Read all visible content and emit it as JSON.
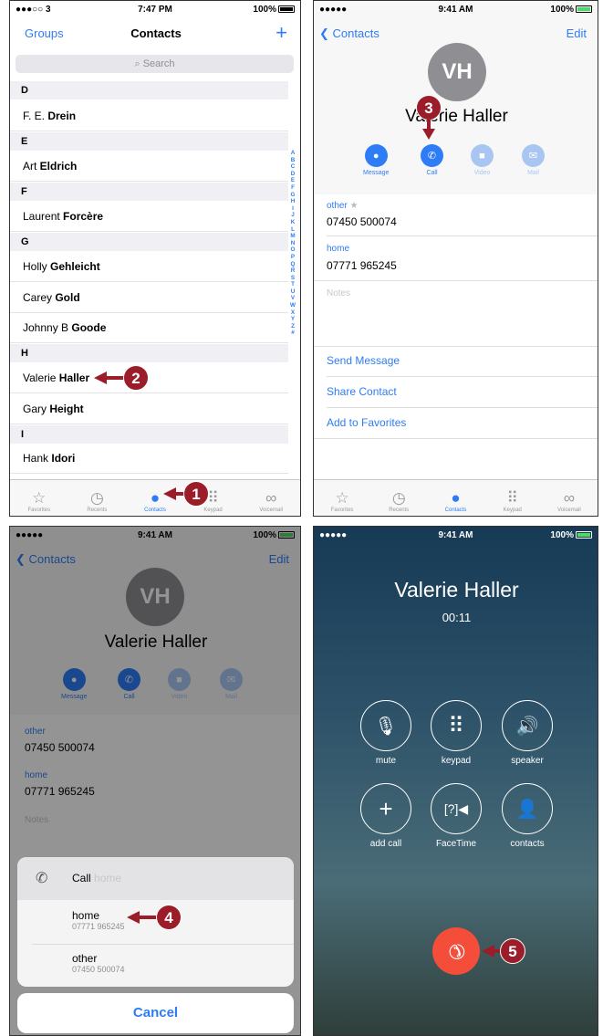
{
  "colors": {
    "accent": "#2e7cf6",
    "callout": "#9b1d2a",
    "end_call": "#f44e3b",
    "search_bg": "#e6e6eb"
  },
  "panel1": {
    "status": {
      "carrier": "●●●○○ 3 ",
      "time": "7:47 PM",
      "battery": "100%"
    },
    "nav": {
      "left": "Groups",
      "title": "Contacts",
      "add": "+"
    },
    "search": {
      "placeholder": "Search",
      "icon": "search-icon"
    },
    "sections": [
      {
        "letter": "D",
        "rows": [
          {
            "first": "F. E. ",
            "last": "Drein"
          }
        ]
      },
      {
        "letter": "E",
        "rows": [
          {
            "first": "Art ",
            "last": "Eldrich"
          }
        ]
      },
      {
        "letter": "F",
        "rows": [
          {
            "first": "Laurent ",
            "last": "Forcère"
          }
        ]
      },
      {
        "letter": "G",
        "rows": [
          {
            "first": "Holly ",
            "last": "Gehleicht"
          },
          {
            "first": "Carey ",
            "last": "Gold"
          },
          {
            "first": "Johnny B ",
            "last": "Goode"
          }
        ]
      },
      {
        "letter": "H",
        "rows": [
          {
            "first": "Valerie ",
            "last": "Haller"
          },
          {
            "first": "Gary ",
            "last": "Height"
          }
        ]
      },
      {
        "letter": "I",
        "rows": [
          {
            "first": "Hank ",
            "last": "Idori"
          }
        ]
      }
    ],
    "index": "A B C D E F G H I J K L M N O P Q R S T U V W X Y Z #",
    "tabs": [
      {
        "label": "Favorites",
        "icon": "star-icon"
      },
      {
        "label": "Recents",
        "icon": "clock-icon"
      },
      {
        "label": "Contacts",
        "icon": "person-icon"
      },
      {
        "label": "Keypad",
        "icon": "keypad-icon"
      },
      {
        "label": "Voicemail",
        "icon": "voicemail-icon"
      }
    ],
    "callout1": "1",
    "callout2": "2"
  },
  "panel2": {
    "status": {
      "carrier": "●●●●● ",
      "time": "9:41 AM",
      "battery": "100%"
    },
    "nav": {
      "back": "Contacts",
      "edit": "Edit"
    },
    "initials": "VH",
    "name": "Valerie Haller",
    "actions": [
      {
        "label": "Message",
        "icon": "message-icon"
      },
      {
        "label": "Call",
        "icon": "phone-icon"
      },
      {
        "label": "Video",
        "icon": "video-icon"
      },
      {
        "label": "Mail",
        "icon": "mail-icon"
      }
    ],
    "phones": [
      {
        "label": "other",
        "star": "★",
        "number": "07450 500074"
      },
      {
        "label": "home",
        "number": "07771 965245"
      }
    ],
    "notes": "Notes",
    "links": [
      "Send Message",
      "Share Contact",
      "Add to Favorites"
    ],
    "tabs": [
      {
        "label": "Favorites"
      },
      {
        "label": "Recents"
      },
      {
        "label": "Contacts"
      },
      {
        "label": "Keypad"
      },
      {
        "label": "Voicemail"
      }
    ],
    "callout3": "3"
  },
  "panel3": {
    "status": {
      "carrier": "●●●●● ",
      "time": "9:41 AM",
      "battery": "100%"
    },
    "nav": {
      "back": "Contacts",
      "edit": "Edit"
    },
    "initials": "VH",
    "name": "Valerie Haller",
    "actions": [
      {
        "label": "Message"
      },
      {
        "label": "Call"
      },
      {
        "label": "Video"
      },
      {
        "label": "Mail"
      }
    ],
    "phones": [
      {
        "label": "other",
        "number": "07450 500074"
      },
      {
        "label": "home",
        "number": "07771 965245"
      }
    ],
    "notes": "Notes",
    "sheet": {
      "title": "Call",
      "title_hint": "home",
      "options": [
        {
          "label": "home",
          "number": "07771 965245"
        },
        {
          "label": "other",
          "number": "07450 500074"
        }
      ],
      "cancel": "Cancel"
    },
    "callout4": "4"
  },
  "panel4": {
    "status": {
      "carrier": "●●●●● ",
      "time": "9:41 AM",
      "battery": "100%"
    },
    "name": "Valerie Haller",
    "timer": "00:11",
    "buttons": [
      {
        "label": "mute",
        "icon": "mute-icon"
      },
      {
        "label": "keypad",
        "icon": "keypad-icon"
      },
      {
        "label": "speaker",
        "icon": "speaker-icon"
      },
      {
        "label": "add call",
        "icon": "plus-icon"
      },
      {
        "label": "FaceTime",
        "icon": "facetime-icon"
      },
      {
        "label": "contacts",
        "icon": "contacts-icon"
      }
    ],
    "callout5": "5"
  }
}
